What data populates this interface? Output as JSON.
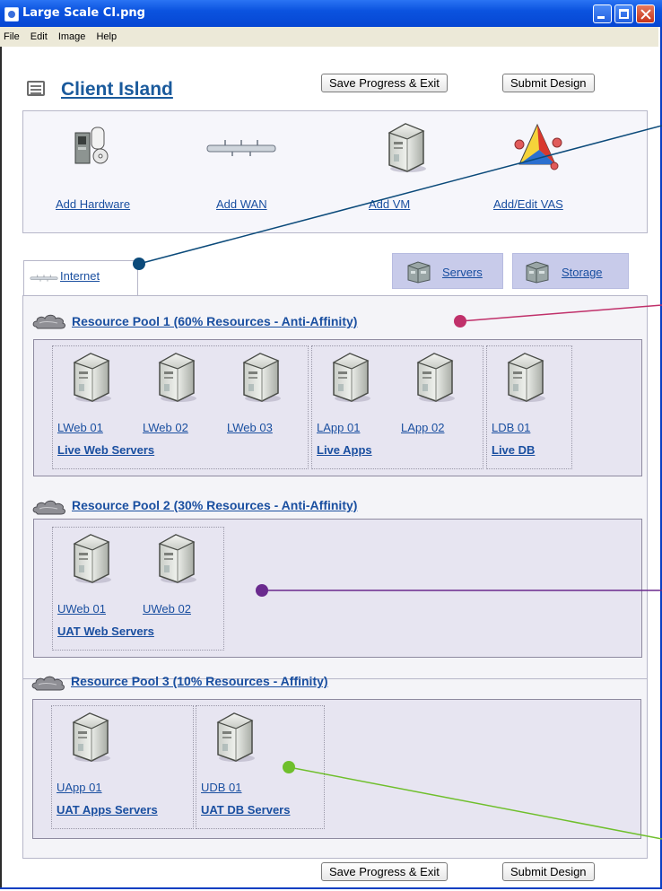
{
  "window": {
    "title": "Large Scale CI.png"
  },
  "menu": [
    "File",
    "Edit",
    "Image",
    "Help"
  ],
  "header": {
    "title": "Client Island",
    "save_label": "Save Progress & Exit",
    "submit_label": "Submit Design"
  },
  "tools": {
    "hardware": "Add Hardware",
    "wan": "Add WAN",
    "vm": "Add VM",
    "vas": "Add/Edit VAS"
  },
  "tabs": {
    "internet": "Internet",
    "servers": "Servers",
    "storage": "Storage"
  },
  "pools": [
    {
      "title": "Resource Pool 1 (60% Resources - Anti-Affinity)",
      "groups": [
        {
          "label": "Live Web Servers",
          "servers": [
            "LWeb 01",
            "LWeb 02",
            "LWeb 03"
          ]
        },
        {
          "label": "Live Apps",
          "servers": [
            "LApp 01",
            "LApp 02"
          ]
        },
        {
          "label": "Live DB",
          "servers": [
            "LDB 01"
          ]
        }
      ]
    },
    {
      "title": "Resource Pool 2 (30% Resources - Anti-Affinity)",
      "groups": [
        {
          "label": "UAT Web Servers",
          "servers": [
            "UWeb 01",
            "UWeb 02"
          ]
        }
      ]
    },
    {
      "title": "Resource Pool 3 (10% Resources - Affinity)",
      "groups": [
        {
          "label": "UAT Apps Servers",
          "servers": [
            "UApp 01"
          ]
        },
        {
          "label": "UAT DB Servers",
          "servers": [
            "UDB 01"
          ]
        }
      ]
    }
  ],
  "footer": {
    "save_label": "Save Progress & Exit",
    "submit_label": "Submit Design"
  },
  "colors": {
    "callout_internet": "#0b4a7a",
    "callout_pool1": "#c0306a",
    "callout_pool2": "#6a2a8e",
    "callout_pool3": "#6fbf2c"
  }
}
